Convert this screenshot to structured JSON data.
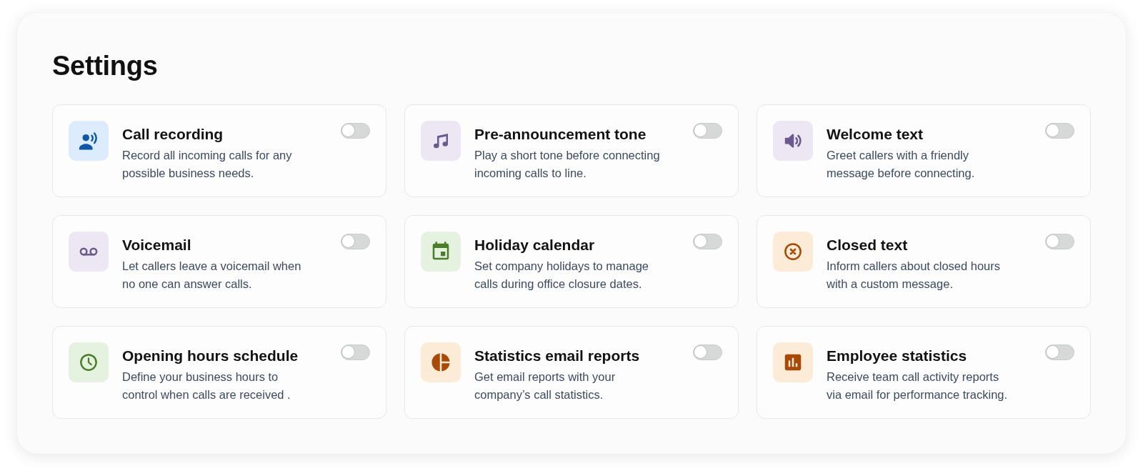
{
  "title": "Settings",
  "settings": [
    {
      "title": "Call recording",
      "description": "Record all incoming calls for any possible business needs.",
      "on": false
    },
    {
      "title": "Pre-announcement tone",
      "description": "Play a short tone before connecting incoming calls to line.",
      "on": false
    },
    {
      "title": "Welcome text",
      "description": "Greet callers with a friendly message before connecting.",
      "on": false
    },
    {
      "title": "Voicemail",
      "description": "Let callers leave a voicemail when no one can answer calls.",
      "on": false
    },
    {
      "title": "Holiday calendar",
      "description": "Set company holidays to manage calls during office closure dates.",
      "on": false
    },
    {
      "title": "Closed text",
      "description": "Inform callers about closed hours with a custom message.",
      "on": false
    },
    {
      "title": "Opening hours schedule",
      "description": "Define your business hours to control when calls are received .",
      "on": false
    },
    {
      "title": "Statistics email reports",
      "description": "Get email reports with your company’s call statistics.",
      "on": false
    },
    {
      "title": "Employee statistics",
      "description": "Receive team call activity reports via email for performance tracking.",
      "on": false
    }
  ]
}
